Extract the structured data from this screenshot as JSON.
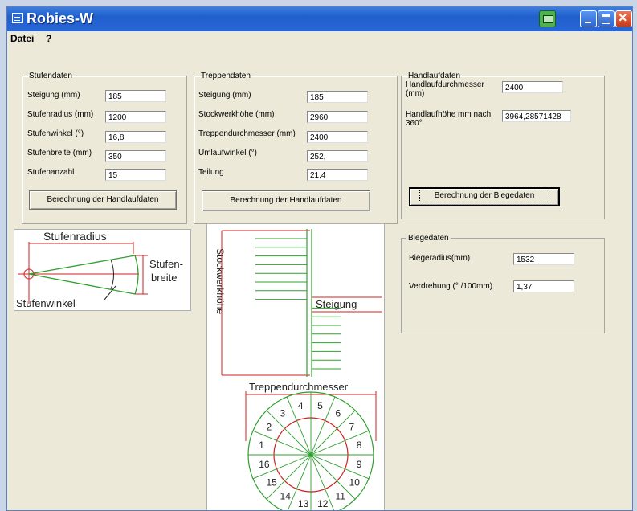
{
  "window": {
    "title": "Robies-W"
  },
  "menu": {
    "items": [
      "Datei",
      "?"
    ]
  },
  "stufendaten": {
    "legend": "Stufendaten",
    "fields": [
      {
        "label": "Steigung (mm)",
        "value": "185"
      },
      {
        "label": "Stufenradius (mm)",
        "value": "1200"
      },
      {
        "label": "Stufenwinkel (°)",
        "value": "16,8"
      },
      {
        "label": "Stufenbreite (mm)",
        "value": "350"
      },
      {
        "label": "Stufenanzahl",
        "value": "15"
      }
    ],
    "button": "Berechnung der Handlaufdaten"
  },
  "treppendaten": {
    "legend": "Treppendaten",
    "fields": [
      {
        "label": "Steigung (mm)",
        "value": "185"
      },
      {
        "label": "Stockwerkhöhe (mm)",
        "value": "2960"
      },
      {
        "label": "Treppendurchmesser (mm)",
        "value": "2400"
      },
      {
        "label": "Umlaufwinkel (°)",
        "value": "252,"
      },
      {
        "label": "Teilung",
        "value": "21,4"
      }
    ],
    "button": "Berechnung der Handlaufdaten"
  },
  "handlaufdaten": {
    "legend": "Handlaufdaten",
    "fields": [
      {
        "label": "Handlaufdurchmesser (mm)",
        "value": "2400"
      },
      {
        "label": "Handlaufhöhe mm nach 360°",
        "value": "3964,28571428"
      }
    ],
    "button": "Berechnung der Biegedaten"
  },
  "biegedaten": {
    "legend": "Biegedaten",
    "fields": [
      {
        "label": "Biegeradius(mm)",
        "value": "1532"
      },
      {
        "label": "Verdrehung (° /100mm)",
        "value": "1,37"
      }
    ]
  },
  "diagram_stufe": {
    "title": "Stufenradius",
    "breite_line1": "Stufen-",
    "breite_line2": "breite",
    "winkel": "Stufenwinkel"
  },
  "diagram_treppe": {
    "stockwerk": "Stockwerkhöhe",
    "steigung": "Steigung",
    "durchmesser": "Treppendurchmesser",
    "numbers": [
      "1",
      "2",
      "3",
      "4",
      "5",
      "6",
      "7",
      "8",
      "9",
      "10",
      "11",
      "12",
      "13",
      "14",
      "15",
      "16"
    ]
  },
  "colors": {
    "titlebar": "#2a66d6",
    "diagram_green": "#2ea02e",
    "diagram_red": "#d02020",
    "window_bg": "#ece9d8"
  }
}
